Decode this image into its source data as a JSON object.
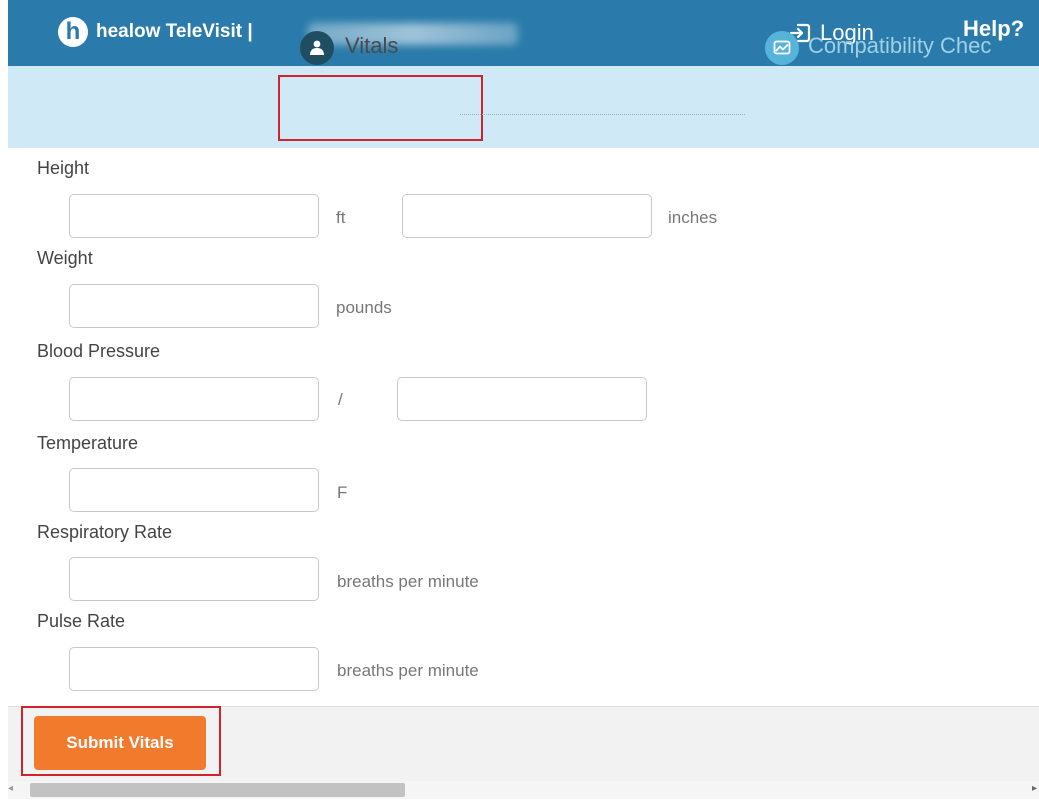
{
  "header": {
    "logo_letter": "h",
    "brand": "healow TeleVisit |",
    "login_label": "Login",
    "help_label": "Help?"
  },
  "steps": {
    "vitals": "Vitals",
    "compatibility": "Compatibility Chec"
  },
  "form": {
    "height_label": "Height",
    "height_ft_unit": "ft",
    "height_in_unit": "inches",
    "weight_label": "Weight",
    "weight_unit": "pounds",
    "bp_label": "Blood Pressure",
    "bp_separator": "/",
    "temperature_label": "Temperature",
    "temperature_unit": "F",
    "respiratory_label": "Respiratory Rate",
    "respiratory_unit": "breaths per minute",
    "pulse_label": "Pulse Rate",
    "pulse_unit": "breaths per minute"
  },
  "footer": {
    "submit_label": "Submit Vitals"
  },
  "colors": {
    "header_bg": "#2a7bab",
    "steps_bg": "#cfe9f6",
    "highlight_border": "#d0232a",
    "submit_bg": "#f27a2c"
  }
}
